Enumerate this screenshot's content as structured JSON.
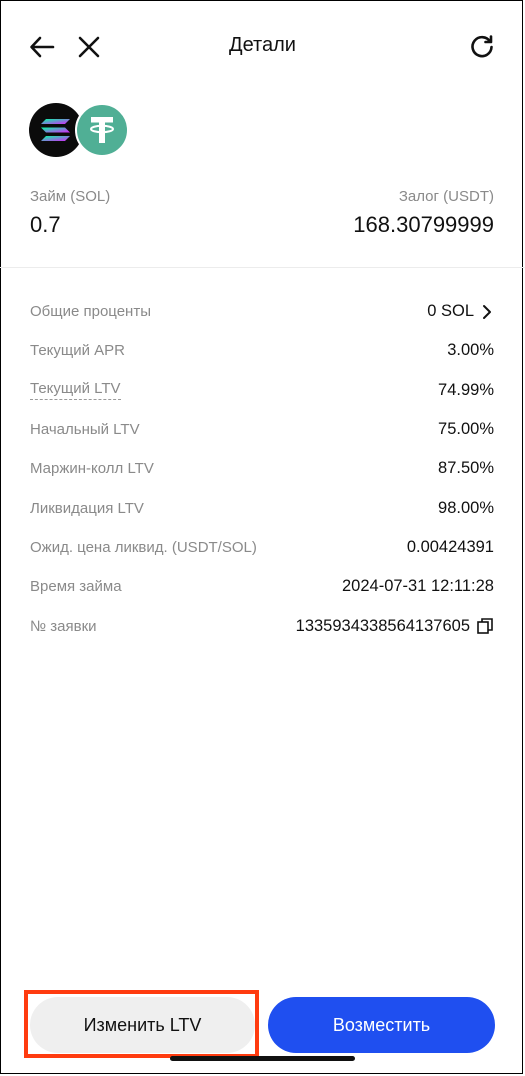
{
  "header": {
    "title": "Детали",
    "icons": {
      "back": "arrow-left-icon",
      "close": "close-icon",
      "refresh": "refresh-icon"
    }
  },
  "coins": {
    "loan_coin": "solana-icon",
    "collateral_coin": "tether-icon"
  },
  "summary": {
    "loan_label": "Займ (SOL)",
    "loan_value": "0.7",
    "collateral_label": "Залог (USDT)",
    "collateral_value": "168.30799999"
  },
  "details": [
    {
      "label": "Общие проценты",
      "value": "0 SOL",
      "chevron": true
    },
    {
      "label": "Текущий APR",
      "value": "3.00%"
    },
    {
      "label": "Текущий LTV",
      "value": "74.99%",
      "dashed": true
    },
    {
      "label": "Начальный LTV",
      "value": "75.00%"
    },
    {
      "label": "Маржин-колл LTV",
      "value": "87.50%"
    },
    {
      "label": "Ликвидация LTV",
      "value": "98.00%"
    },
    {
      "label": "Ожид. цена ликвид. (USDT/SOL)",
      "value": "0.00424391"
    },
    {
      "label": "Время займа",
      "value": "2024-07-31 12:11:28"
    },
    {
      "label": "№ заявки",
      "value": "1335934338564137605",
      "copy": true
    }
  ],
  "actions": {
    "adjust_ltv_label": "Изменить LTV",
    "repay_label": "Возместить"
  },
  "colors": {
    "primary": "#1f4ff0",
    "highlight": "#ff3b0f",
    "usdt": "#50AF95"
  }
}
